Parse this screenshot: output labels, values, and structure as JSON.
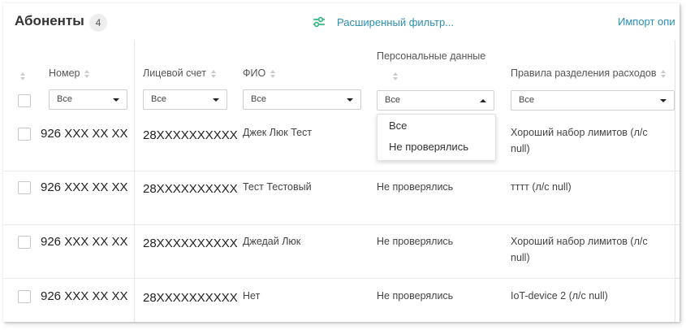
{
  "header": {
    "title": "Абоненты",
    "count": "4",
    "filter_label": "Расширенный фильтр...",
    "import_label": "Импорт опи"
  },
  "columns": {
    "number": "Номер",
    "account": "Лицевой счет",
    "name": "ФИО",
    "personal": "Персональные данные",
    "rules": "Правила разделения расходов"
  },
  "filters": {
    "number": "Все",
    "account": "Все",
    "name": "Все",
    "personal": "Все",
    "rules": "Все"
  },
  "dropdown": {
    "options": [
      "Все",
      "Не проверялись"
    ]
  },
  "rows": [
    {
      "number": "926 XXX XX XX",
      "account": "28XXXXXXXXXX",
      "name": "Джек Люк Тест",
      "personal": "",
      "rules": [
        "Хороший набор лимитов (л/с",
        "null)"
      ]
    },
    {
      "number": "926 XXX XX XX",
      "account": "28XXXXXXXXXX",
      "name": "Тест Тестовый",
      "personal": "Не проверялись",
      "rules": [
        "тттт (л/с null)"
      ]
    },
    {
      "number": "926 XXX XX XX",
      "account": "28XXXXXXXXXX",
      "name": "Джедай Люк",
      "personal": "Не проверялись",
      "rules": [
        "Хороший набор лимитов (л/с",
        "null)"
      ]
    },
    {
      "number": "926 XXX XX XX",
      "account": "28XXXXXXXXXX",
      "name": "Нет",
      "personal": "Не проверялись",
      "rules": [
        "IoT-device 2 (л/с null)"
      ]
    }
  ],
  "colors": {
    "link": "#2a8fb5",
    "filter_icon": "#2bb37a",
    "text": "#333333",
    "badge_bg": "#eeeeee"
  }
}
